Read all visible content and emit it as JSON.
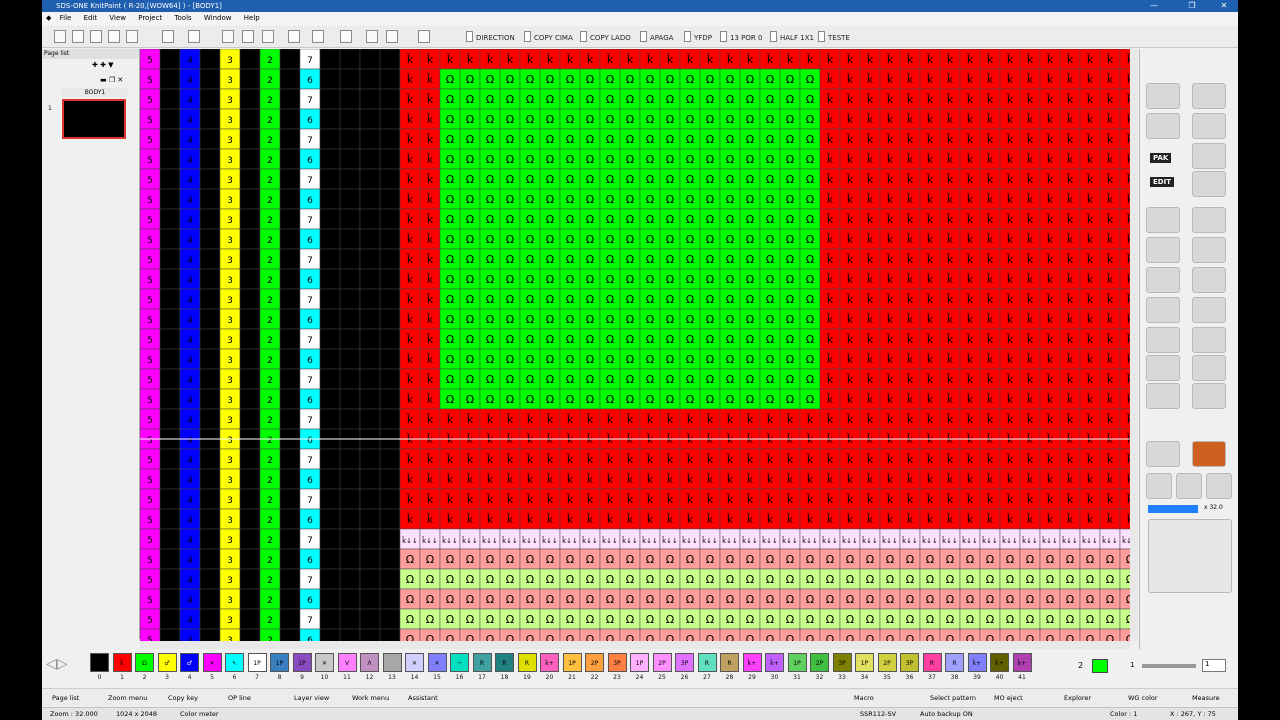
{
  "window": {
    "title": "SDS-ONE KnitPaint ( R-20,[WOW64] ) - [BODY1]"
  },
  "menu": [
    "File",
    "Edit",
    "View",
    "Project",
    "Tools",
    "Window",
    "Help"
  ],
  "macros": [
    "DIRECTION",
    "COPY CIMA",
    "COPY LADO",
    "APAGA",
    "YFDP",
    "13 POR 0",
    "HALF 1X1",
    "TESTE"
  ],
  "page_list": {
    "title": "Page list",
    "page_name": "BODY1",
    "page_number": "1"
  },
  "canvas": {
    "column_numbers": [
      "5",
      "4",
      "3",
      "2",
      "7",
      "6"
    ],
    "row_colors": {
      "magenta": "#ff00ff",
      "blue": "#0000ff",
      "yellow": "#ffff00",
      "green": "#00ff00",
      "white": "#ffffff",
      "cyan": "#00ffff",
      "red": "#ff0000",
      "pink": "#ff9c9c",
      "lightgreen": "#c8ff8c"
    },
    "symbols": {
      "red": "ǩ",
      "green": "Ω",
      "transfer": "ǩ↓↓"
    }
  },
  "right_panel": {
    "edit_label": "EDIT",
    "pak_label": "PAK",
    "zoom_label": "x 32.0"
  },
  "palette": [
    {
      "n": "0",
      "c": "#000000",
      "t": ""
    },
    {
      "n": "1",
      "c": "#ff0000",
      "t": "ǩ"
    },
    {
      "n": "2",
      "c": "#00ff00",
      "t": "Ω"
    },
    {
      "n": "3",
      "c": "#ffff00",
      "t": "♂"
    },
    {
      "n": "4",
      "c": "#0000ff",
      "t": "♂"
    },
    {
      "n": "5",
      "c": "#ff00ff",
      "t": "✕"
    },
    {
      "n": "6",
      "c": "#00ffff",
      "t": "↖"
    },
    {
      "n": "7",
      "c": "#ffffff",
      "t": "1P"
    },
    {
      "n": "8",
      "c": "#3a7fbf",
      "t": "1P"
    },
    {
      "n": "9",
      "c": "#8a4ac0",
      "t": "1P"
    },
    {
      "n": "10",
      "c": "#c8c8c8",
      "t": "✕"
    },
    {
      "n": "11",
      "c": "#ff80ff",
      "t": "V"
    },
    {
      "n": "12",
      "c": "#c090c0",
      "t": "Λ"
    },
    {
      "n": "13",
      "c": "#a8a8a8",
      "t": ""
    },
    {
      "n": "14",
      "c": "#d0d0ff",
      "t": "✕"
    },
    {
      "n": "15",
      "c": "#8080ff",
      "t": "✕"
    },
    {
      "n": "16",
      "c": "#00e0c0",
      "t": "─"
    },
    {
      "n": "17",
      "c": "#40a0a0",
      "t": "R"
    },
    {
      "n": "18",
      "c": "#208080",
      "t": "R"
    },
    {
      "n": "19",
      "c": "#e0e000",
      "t": "R"
    },
    {
      "n": "20",
      "c": "#ff60c0",
      "t": "ǩ+"
    },
    {
      "n": "21",
      "c": "#ffc040",
      "t": "1P"
    },
    {
      "n": "22",
      "c": "#ffa040",
      "t": "2P"
    },
    {
      "n": "23",
      "c": "#ff8040",
      "t": "3P"
    },
    {
      "n": "24",
      "c": "#ffb0ff",
      "t": "1P"
    },
    {
      "n": "25",
      "c": "#ff90ff",
      "t": "2P"
    },
    {
      "n": "26",
      "c": "#e070ff",
      "t": "3P"
    },
    {
      "n": "27",
      "c": "#60e0c0",
      "t": "R"
    },
    {
      "n": "28",
      "c": "#c0a060",
      "t": "R"
    },
    {
      "n": "29",
      "c": "#ff40ff",
      "t": "ǩ+"
    },
    {
      "n": "30",
      "c": "#c060ff",
      "t": "ǩ+"
    },
    {
      "n": "31",
      "c": "#60d060",
      "t": "1P"
    },
    {
      "n": "32",
      "c": "#40c040",
      "t": "2P"
    },
    {
      "n": "33",
      "c": "#808000",
      "t": "3P"
    },
    {
      "n": "34",
      "c": "#e0e060",
      "t": "1P"
    },
    {
      "n": "35",
      "c": "#d0d040",
      "t": "2P"
    },
    {
      "n": "36",
      "c": "#c0c030",
      "t": "3P"
    },
    {
      "n": "37",
      "c": "#ff40a0",
      "t": "R"
    },
    {
      "n": "38",
      "c": "#a0a0ff",
      "t": "R"
    },
    {
      "n": "39",
      "c": "#8080ff",
      "t": "ǩ+"
    },
    {
      "n": "40",
      "c": "#606000",
      "t": "ǩ+"
    },
    {
      "n": "41",
      "c": "#b040b0",
      "t": "ǩ+"
    }
  ],
  "palette_controls": {
    "current_color_number": "2",
    "current_color": "#00ff00",
    "page_field": "1",
    "hint_label": "1"
  },
  "bottom_bar": [
    "Page list",
    "Zoom menu",
    "Copy key",
    "OP line",
    "Layer view",
    "Work menu",
    "Assistant",
    "Macro",
    "Select pattern",
    "MO eject",
    "Explorer",
    "WG color",
    "Measure"
  ],
  "status": {
    "zoom": "Zoom : 32.000",
    "size": "1024 x 2048",
    "meter": "Color meter",
    "machine": "SSR112-SV",
    "backup": "Auto backup ON",
    "color": "Color : 1",
    "coords": "X : 267, Y : 75"
  }
}
